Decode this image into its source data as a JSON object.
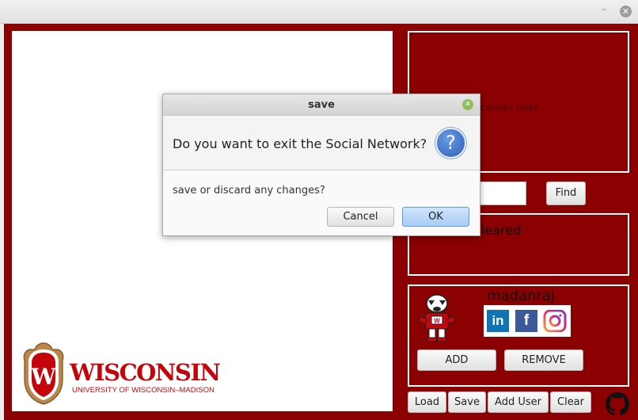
{
  "window": {
    "minimize_glyph": "–",
    "close_glyph": "✕"
  },
  "logo": {
    "wordmark": "WISCONSIN",
    "subtitle": "UNIVERSITY OF WISCONSIN–MADISON",
    "crest_letter": "W"
  },
  "main_panel": {
    "center_message": "Need to set center user"
  },
  "search": {
    "value": "",
    "placeholder": "",
    "find_label": "Find"
  },
  "status": {
    "text": "Cleared"
  },
  "user_card": {
    "username": "madanraj",
    "social": {
      "linkedin": "in",
      "facebook": "f"
    },
    "add_label": "ADD",
    "remove_label": "REMOVE"
  },
  "toolbar": {
    "load_label": "Load",
    "save_label": "Save",
    "add_user_label": "Add User",
    "clear_label": "Clear"
  },
  "dialog": {
    "title": "save",
    "header": "Do you want to exit the Social Network?",
    "icon_glyph": "?",
    "content": "save or discard any changes?",
    "cancel_label": "Cancel",
    "ok_label": "OK",
    "close_glyph": "✕"
  },
  "colors": {
    "app_background": "#8b0000",
    "brand_red": "#c5050c",
    "panel_border": "#ffffff"
  }
}
